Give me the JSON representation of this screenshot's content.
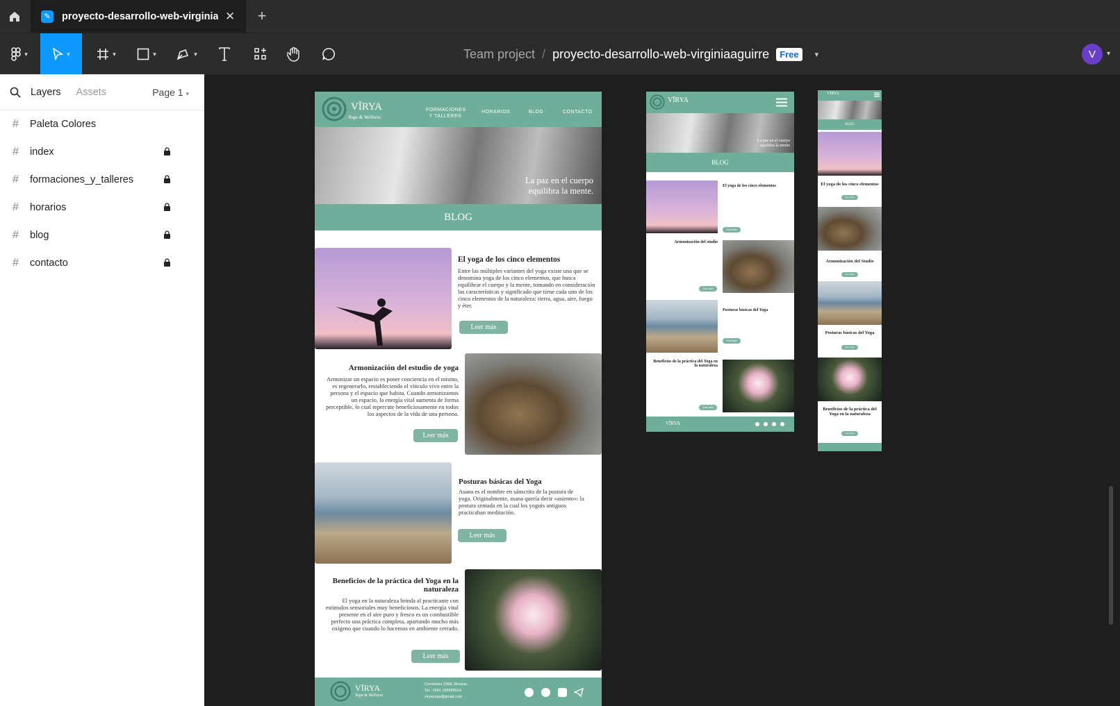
{
  "tabbar": {
    "file_tab_title": "proyecto-desarrollo-web-virginiaaguirre",
    "close_glyph": "✕",
    "new_tab_glyph": "+"
  },
  "toolbar": {
    "project": "Team project",
    "separator": "/",
    "file_name": "proyecto-desarrollo-web-virginiaaguirre",
    "plan_badge": "Free",
    "avatar_letter": "V"
  },
  "left_panel": {
    "tab_layers": "Layers",
    "tab_assets": "Assets",
    "page_selector": "Page 1",
    "layers": [
      {
        "name": "Paleta Colores",
        "locked": false
      },
      {
        "name": "index",
        "locked": true
      },
      {
        "name": "formaciones_y_talleres",
        "locked": true
      },
      {
        "name": "horarios",
        "locked": true
      },
      {
        "name": "blog",
        "locked": true
      },
      {
        "name": "contacto",
        "locked": true
      }
    ]
  },
  "desktop": {
    "logo": "VĪRYA",
    "logo_sub": "Yoga & Wellness",
    "nav": [
      "FORMACIONES Y TALLERES",
      "HORARIOS",
      "BLOG",
      "CONTACTO"
    ],
    "hero_text_1": "La paz en el cuerpo",
    "hero_text_2": "equilibra la mente.",
    "band": "BLOG",
    "posts": [
      {
        "title": "El yoga de los cinco elementos",
        "body": "Entre las múltiples variantes del yoga existe una que se denomina yoga de los cinco elementos, que busca equilibrar el cuerpo y la mente, tomando en consideración las características y significado que tiene cada uno de los cinco elementos de la naturaleza: tierra, agua, aire, fuego y éter.",
        "button": "Leer más"
      },
      {
        "title": "Armonización del estudio de yoga",
        "body": "Armonizar un espacio es poner conciencia en el mismo, es regenerarlo, restableciendo el vínculo vivo entre la persona y el espacio que habita. Cuando armonizamos un espacio, la energía vital aumenta de forma perceptible, lo cual repercute beneficiosamente en todos los aspectos de la vida de una persona.",
        "button": "Leer más"
      },
      {
        "title": "Posturas básicas del Yoga",
        "body": "Asana es el nombre en sánscrito de la postura de yoga. Originalmente, asana quería decir «asiento»: la postura sentada en la cual los yoguis antiguos practicaban meditación.",
        "button": "Leer más"
      },
      {
        "title": "Beneficios de la práctica del Yoga en la naturaleza",
        "body": "El yoga en la naturaleza brinda al practicante con estímulos sensoriales muy beneficiosos. La energía vital presente en el aire puro y fresco es un combustible perfecto una práctica completa, apartando mucho más oxígeno que cuando lo hacemos en ambiente cerrado.",
        "button": "Leer más"
      }
    ],
    "footer": {
      "address": "Corrientes 2568, Rosario.",
      "phone": "Tel.: 0341 156983514",
      "email": "viryayoga@gmail.com"
    }
  },
  "tablet": {
    "band": "BLOG",
    "hero_text_1": "La paz en el cuerpo",
    "hero_text_2": "equilibra la mente",
    "posts": [
      {
        "title": "El yoga de los cinco elementos",
        "button": "Leer más"
      },
      {
        "title": "Armonización del studio",
        "button": "Leer más"
      },
      {
        "title": "Posturas básicas del Yoga",
        "button": "Leer más"
      },
      {
        "title": "Beneficios de la práctica del Yoga en la naturaleza",
        "button": "Leer más"
      }
    ]
  },
  "mobile": {
    "band": "BLOG",
    "posts": [
      {
        "title": "El yoga de los cinco elementos",
        "button": "Leer más"
      },
      {
        "title": "Armonización del Studio",
        "button": "Leer más"
      },
      {
        "title": "Posturas básicas del Yoga",
        "button": "Leer más"
      },
      {
        "title": "Beneficios de la práctica del Yoga en la naturaleza",
        "button": "Leer más"
      }
    ]
  },
  "colors": {
    "accent": "#0d99ff",
    "brand_green": "#6fae9b",
    "button_green": "#7fb3a4",
    "avatar": "#6a3fc7"
  }
}
